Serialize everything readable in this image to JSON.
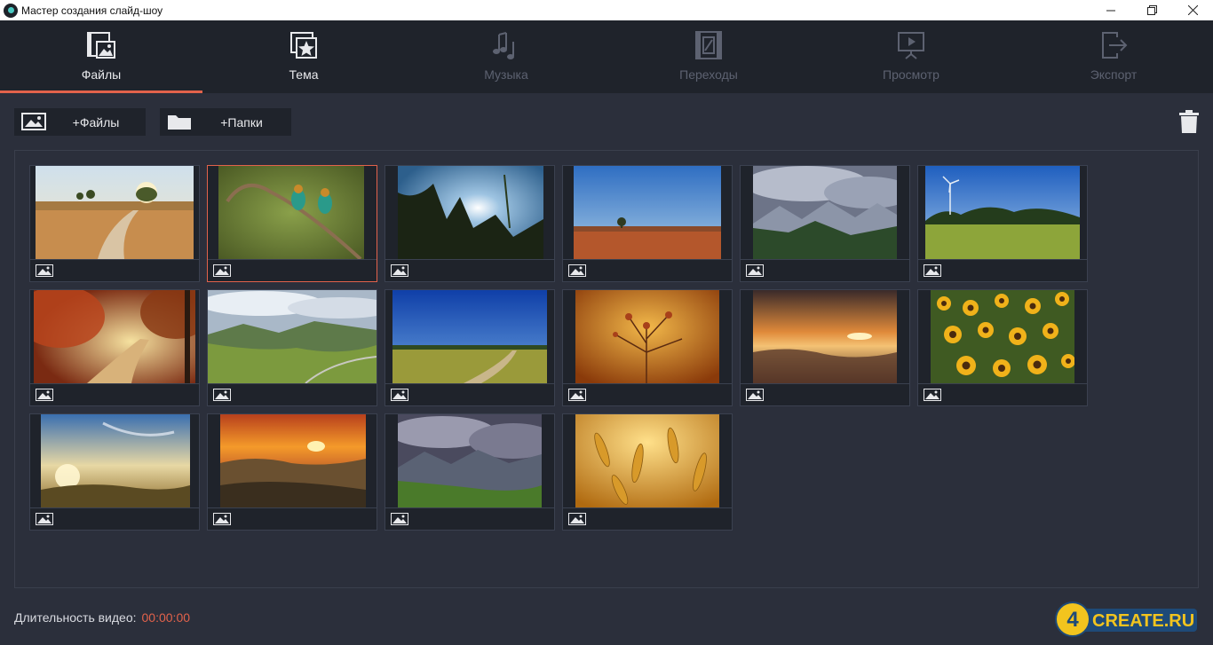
{
  "window": {
    "title": "Мастер создания слайд-шоу"
  },
  "tabs": [
    {
      "label": "Файлы",
      "icon": "film-image-icon",
      "state": "active"
    },
    {
      "label": "Тема",
      "icon": "star-frame-icon",
      "state": "normal"
    },
    {
      "label": "Музыка",
      "icon": "music-notes-icon",
      "state": "disabled"
    },
    {
      "label": "Переходы",
      "icon": "film-transition-icon",
      "state": "disabled"
    },
    {
      "label": "Просмотр",
      "icon": "preview-screen-icon",
      "state": "disabled"
    },
    {
      "label": "Экспорт",
      "icon": "export-arrow-icon",
      "state": "disabled"
    }
  ],
  "toolbar": {
    "add_files_label": "+Файлы",
    "add_folders_label": "+Папки"
  },
  "accent_color": "#e2624b",
  "photos": [
    {
      "subject": "country road through field",
      "selected": false
    },
    {
      "subject": "bee-eater birds on branch",
      "selected": true
    },
    {
      "subject": "grass against sunlight",
      "selected": false
    },
    {
      "subject": "red field under blue sky",
      "selected": false
    },
    {
      "subject": "mountain valley with clouds",
      "selected": false
    },
    {
      "subject": "wind turbines over meadow",
      "selected": false
    },
    {
      "subject": "autumn forest path",
      "selected": false
    },
    {
      "subject": "green mountain valley",
      "selected": false
    },
    {
      "subject": "dirt road across field",
      "selected": false
    },
    {
      "subject": "dry flowers at sunset",
      "selected": false
    },
    {
      "subject": "sunset over sea",
      "selected": false
    },
    {
      "subject": "sunflower field",
      "selected": false
    },
    {
      "subject": "misty sunrise landscape",
      "selected": false
    },
    {
      "subject": "orange sunset over hills",
      "selected": false
    },
    {
      "subject": "stormy clouds over mountains",
      "selected": false
    },
    {
      "subject": "golden wheat ears",
      "selected": false
    }
  ],
  "footer": {
    "duration_label": "Длительность видео:",
    "duration_value": "00:00:00"
  },
  "watermark": {
    "text": "4CREATE.RU"
  }
}
